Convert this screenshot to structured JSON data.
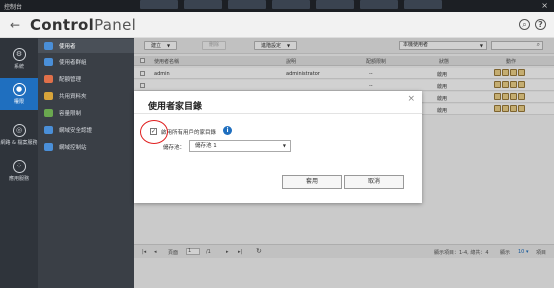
{
  "window": {
    "title": "控制台"
  },
  "header": {
    "brand_bold": "Control",
    "brand_rest": "Panel"
  },
  "rail": {
    "items": [
      {
        "label": "系統",
        "icon": "gear-icon"
      },
      {
        "label": "權限",
        "icon": "user-icon"
      },
      {
        "label": "網路 & 檔案服務",
        "icon": "globe-icon"
      },
      {
        "label": "應用服務",
        "icon": "grid-icon"
      }
    ]
  },
  "sidebar": {
    "items": [
      {
        "label": "使用者",
        "color": "#4a8fd8"
      },
      {
        "label": "使用者群組",
        "color": "#4a8fd8"
      },
      {
        "label": "配額管理",
        "color": "#e0704a"
      },
      {
        "label": "共用資料夾",
        "color": "#d8a43a"
      },
      {
        "label": "容量限制",
        "color": "#6aa84f"
      },
      {
        "label": "網域安全認證",
        "color": "#4a8fd8"
      },
      {
        "label": "網域控制站",
        "color": "#4a8fd8"
      }
    ]
  },
  "toolbar": {
    "create_label": "建立",
    "delete_label": "刪除",
    "advanced_label": "進階設定",
    "filter_value": "本機使用者"
  },
  "table": {
    "headers": [
      "使用者名稱",
      "說明",
      "配額限制",
      "狀態",
      "動作"
    ],
    "rows": [
      {
        "name": "admin",
        "desc": "administrator",
        "quota": "--",
        "status": "啟用"
      },
      {
        "name": "",
        "desc": "",
        "quota": "--",
        "status": "啟用"
      },
      {
        "name": "",
        "desc": "",
        "quota": "--",
        "status": "啟用"
      },
      {
        "name": "",
        "desc": "",
        "quota": "--",
        "status": "啟用"
      }
    ]
  },
  "pager": {
    "page_label": "頁面",
    "page_value": "1",
    "total": "/1",
    "summary": "顯示項目：1-4, 總共：4",
    "per_page_label": "顯示",
    "per_page_value": "10",
    "items_label": "項目"
  },
  "dialog": {
    "title": "使用者家目錄",
    "checkbox_label": "啟用所有用戶的家目錄",
    "volume_label": "儲存池：",
    "volume_value": "儲存池 1",
    "ok_label": "套用",
    "cancel_label": "取消"
  },
  "colors": {
    "accent": "#1f6fbf",
    "highlight_circle": "#e02020"
  }
}
